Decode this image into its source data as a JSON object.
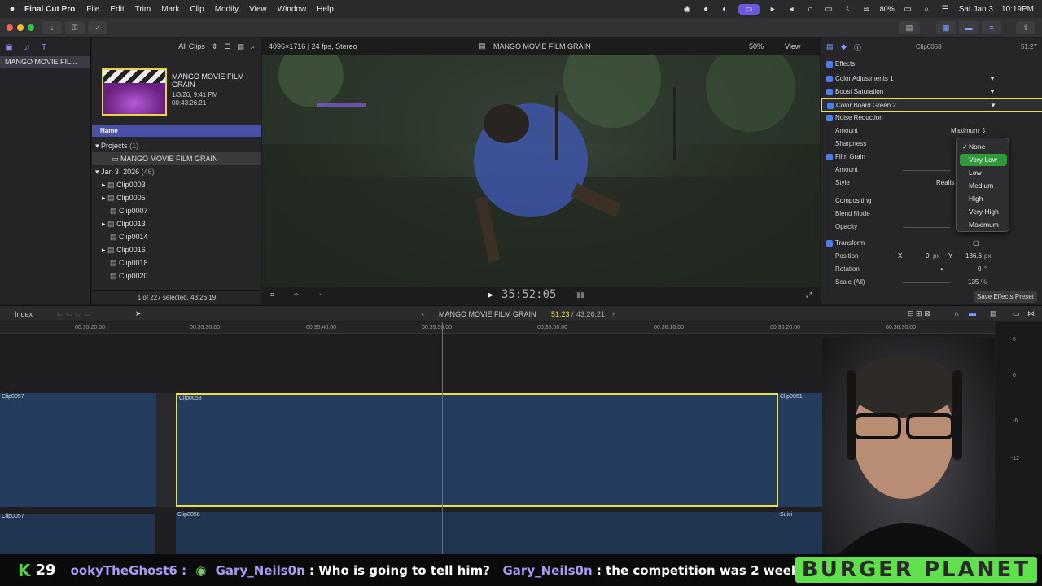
{
  "menubar": {
    "app": "Final Cut Pro",
    "items": [
      "File",
      "Edit",
      "Trim",
      "Mark",
      "Clip",
      "Modify",
      "View",
      "Window",
      "Help"
    ],
    "battery": "80%",
    "date": "Sat Jan 3",
    "time": "10:19PM"
  },
  "library": {
    "item": "MANGO MOVIE FIL..."
  },
  "browser": {
    "filter": "All Clips",
    "project_title": "MANGO MOVIE FILM GRAIN",
    "project_date": "1/3/26, 9:41 PM",
    "project_duration": "00:43:26:21",
    "column_name": "Name",
    "projects_label": "Projects",
    "projects_count": "(1)",
    "project_item": "MANGO MOVIE FILM GRAIN",
    "event_label": "Jan 3, 2026",
    "event_count": "(46)",
    "clips": [
      "Clip0003",
      "Clip0005",
      "Clip0007",
      "Clip0013",
      "Clip0014",
      "Clip0016",
      "Clip0018",
      "Clip0020"
    ],
    "status": "1 of 227 selected, 43:26:19"
  },
  "viewer": {
    "format": "4096×1716 | 24 fps, Stereo",
    "title": "MANGO MOVIE FILM GRAIN",
    "zoom": "50%",
    "view_label": "View",
    "timecode": "35:52:05"
  },
  "inspector": {
    "clip": "Clip0058",
    "duration": "51:27",
    "effects_label": "Effects",
    "effect1": "Color Adjustments 1",
    "effect2": "Boost Saturation",
    "effect3": "Color Board Green 2",
    "noise_reduction": "Noise Reduction",
    "amount_label": "Amount",
    "amount_value": "Maximum",
    "sharpness_label": "Sharpness",
    "film_grain": "Film Grain",
    "fg_amount": "Amount",
    "style_label": "Style",
    "style_value": "Realis",
    "compositing": "Compositing",
    "blend_mode": "Blend Mode",
    "opacity": "Opacity",
    "transform": "Transform",
    "position": "Position",
    "pos_x_label": "X",
    "pos_x": "0",
    "pos_x_unit": "px",
    "pos_y_label": "Y",
    "pos_y": "186.6",
    "pos_y_unit": "px",
    "rotation": "Rotation",
    "rotation_val": "0",
    "rotation_unit": "°",
    "scale": "Scale (All)",
    "scale_val": "135",
    "scale_unit": "%",
    "save_preset": "Save Effects Preset"
  },
  "dropdown": {
    "options": [
      "None",
      "Very Low",
      "Low",
      "Medium",
      "High",
      "Very High",
      "Maximum"
    ],
    "checked": "None",
    "hovered": "Very Low",
    "checkmark": "✓"
  },
  "timeline": {
    "index_label": "Index",
    "project": "MANGO MOVIE FILM GRAIN",
    "position": "51:23",
    "total": "43:26:21",
    "ticks": [
      "00:35:20:00",
      "00:35:30:00",
      "00:35:40:00",
      "00:35:50:00",
      "00:36:00:00",
      "00:36:10:00",
      "00:36:20:00",
      "00:36:30:00"
    ],
    "clips": {
      "a": "Clip0057",
      "b": "Clip0058",
      "c": "Clip0061"
    },
    "audio_clips": {
      "a": "Clip0057",
      "b": "Clip0058",
      "c": "Suici"
    },
    "meter_labels": [
      "6",
      "0",
      "-6",
      "-12"
    ]
  },
  "chat": {
    "k": "K",
    "count": "29",
    "lead": "ookyTheGhost6 :",
    "msg1_user": "Gary_Neils0n",
    "msg1_text": ": Who is going to tell him?",
    "msg2_user": "Gary_Neils0n",
    "msg2_text": ": the competition was 2 weeks ago",
    "banner": "BURGER PLANET"
  },
  "colors": {
    "accent": "#4a4fa8",
    "selection": "#e8e04a",
    "playhead": "#e03a3a",
    "menu_hover": "#2f9a3a"
  }
}
